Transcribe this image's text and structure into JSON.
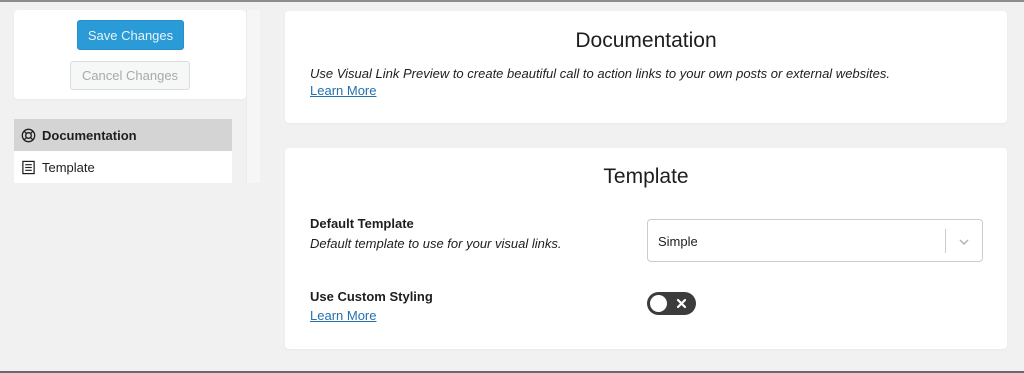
{
  "sidebar": {
    "save_label": "Save Changes",
    "cancel_label": "Cancel Changes",
    "nav": [
      {
        "label": "Documentation",
        "icon": "lifebuoy-icon",
        "active": true
      },
      {
        "label": "Template",
        "icon": "document-icon",
        "active": false
      }
    ]
  },
  "documentation": {
    "title": "Documentation",
    "description": "Use Visual Link Preview to create beautiful call to action links to your own posts or external websites.",
    "link": "Learn More"
  },
  "template": {
    "title": "Template",
    "default_template": {
      "label": "Default Template",
      "help": "Default template to use for your visual links.",
      "value": "Simple"
    },
    "custom_styling": {
      "label": "Use Custom Styling",
      "link": "Learn More",
      "enabled": false
    }
  },
  "colors": {
    "accent": "#2a9bd7",
    "link": "#2271b1",
    "toggle_off": "#3c3c3c",
    "background": "#f1f1f1"
  }
}
